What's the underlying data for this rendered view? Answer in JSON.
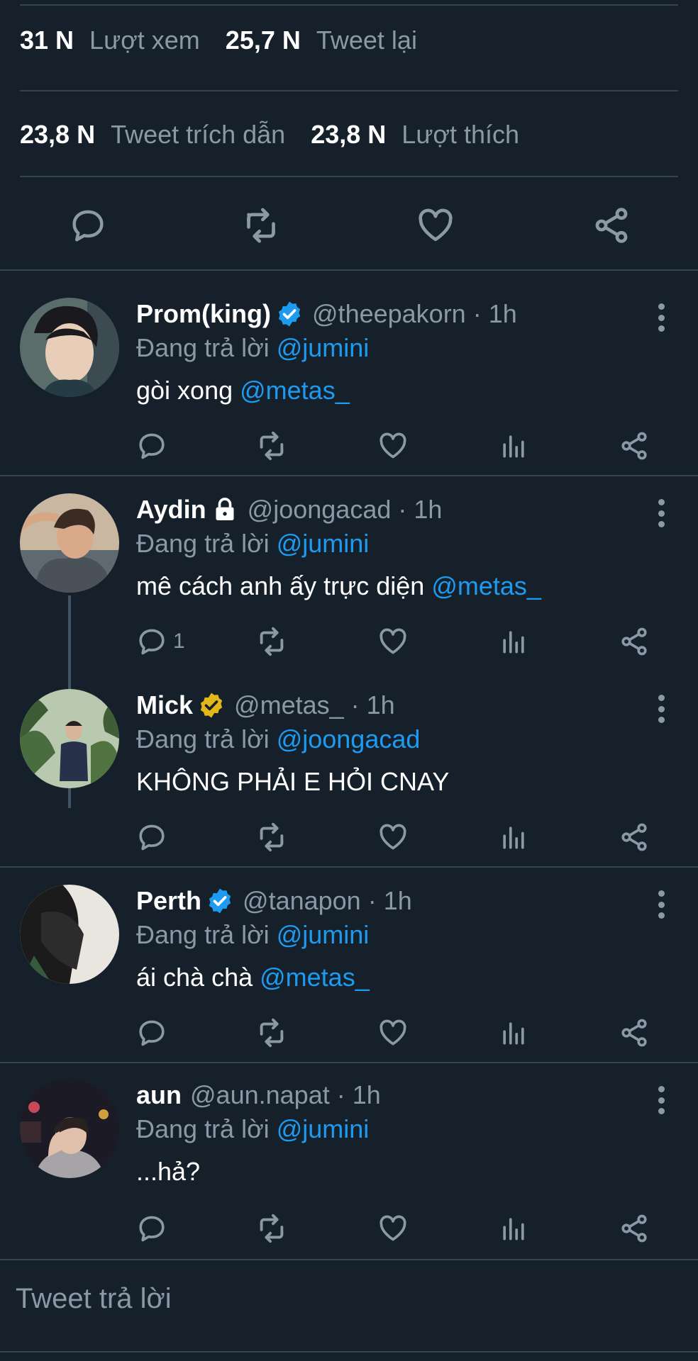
{
  "stats": {
    "views": {
      "num": "31 N",
      "label": "Lượt xem"
    },
    "retweets": {
      "num": "25,7 N",
      "label": "Tweet lại"
    },
    "quotes": {
      "num": "23,8 N",
      "label": "Tweet trích dẫn"
    },
    "likes": {
      "num": "23,8 N",
      "label": "Lượt thích"
    }
  },
  "replies": [
    {
      "name": "Prom(king)",
      "badge": "blue",
      "handle": "@theepakorn · 1h",
      "replying_label": "Đang trả lời",
      "replying_to": "@jumini",
      "text": "gòi xong",
      "text_mention": "@metas_",
      "reply_count": ""
    },
    {
      "name": "Aydin",
      "badge": "lock",
      "handle": "@joongacad · 1h",
      "replying_label": "Đang trả lời",
      "replying_to": "@jumini",
      "text": "mê cách anh ấy trực diện",
      "text_mention": "@metas_",
      "reply_count": "1"
    },
    {
      "name": "Mick",
      "badge": "gold",
      "handle": "@metas_ · 1h",
      "replying_label": "Đang trả lời",
      "replying_to": "@joongacad",
      "text": "KHÔNG PHẢI E HỎI CNAY",
      "text_mention": "",
      "reply_count": ""
    },
    {
      "name": "Perth",
      "badge": "blue",
      "handle": "@tanapon · 1h",
      "replying_label": "Đang trả lời",
      "replying_to": "@jumini",
      "text": "ái chà chà",
      "text_mention": "@metas_",
      "reply_count": ""
    },
    {
      "name": "aun",
      "badge": "none",
      "handle": "@aun.napat · 1h",
      "replying_label": "Đang trả lời",
      "replying_to": "@jumini",
      "text": "...hả?",
      "text_mention": "",
      "reply_count": ""
    }
  ],
  "compose": {
    "placeholder": "Tweet trả lời"
  },
  "colors": {
    "background": "#15202b",
    "accent": "#1d9bf0",
    "muted": "#8b98a5",
    "divider": "#38444d",
    "gold_badge": "#e2b719"
  }
}
